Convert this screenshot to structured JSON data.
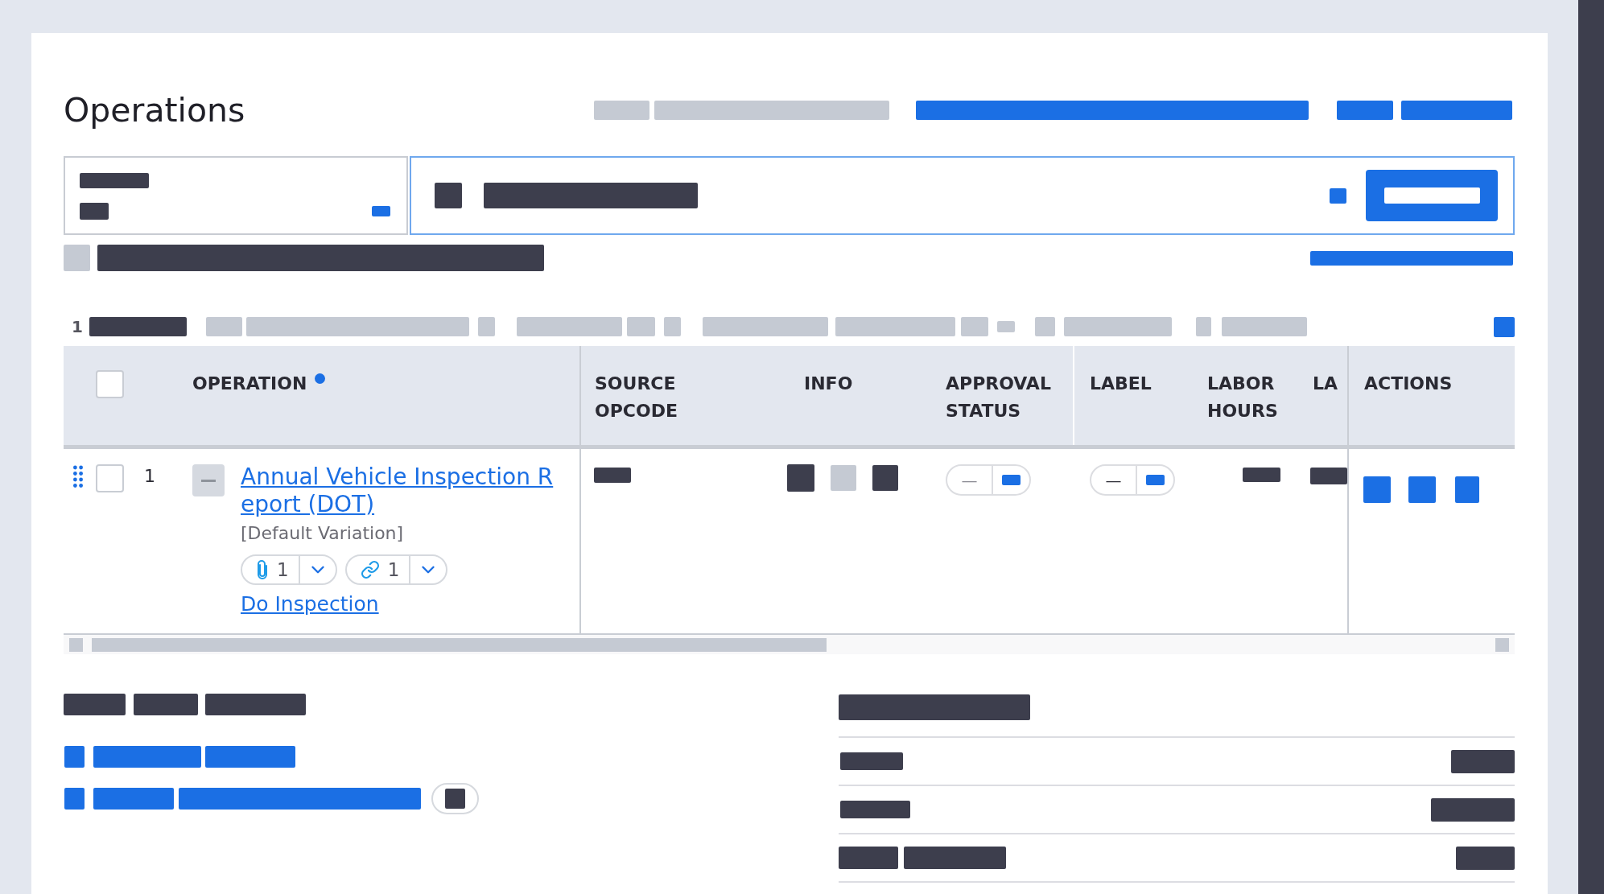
{
  "header": {
    "title": "Operations",
    "redacted": [
      {
        "kind": "muted"
      },
      {
        "kind": "muted"
      },
      {
        "kind": "link"
      },
      {
        "kind": "link"
      },
      {
        "kind": "link"
      }
    ]
  },
  "filter_field": {
    "redacted": [
      {
        "kind": "dark"
      },
      {
        "kind": "dark"
      },
      {
        "kind": "link"
      }
    ]
  },
  "search_field": {
    "focused": true,
    "redacted": [
      {
        "kind": "dark"
      },
      {
        "kind": "dark"
      },
      {
        "kind": "link"
      }
    ]
  },
  "search_button": {
    "redacted": [
      {
        "kind": "light"
      }
    ]
  },
  "summary": {
    "redacted": [
      {
        "kind": "muted"
      },
      {
        "kind": "dark"
      },
      {
        "kind": "link"
      }
    ]
  },
  "toolbar": {
    "count": "1",
    "redacted": [
      {
        "kind": "dark"
      },
      {
        "kind": "muted"
      },
      {
        "kind": "muted"
      },
      {
        "kind": "muted"
      },
      {
        "kind": "muted"
      },
      {
        "kind": "muted"
      },
      {
        "kind": "muted"
      },
      {
        "kind": "muted"
      },
      {
        "kind": "muted"
      },
      {
        "kind": "muted"
      },
      {
        "kind": "muted"
      },
      {
        "kind": "muted"
      },
      {
        "kind": "muted"
      },
      {
        "kind": "muted"
      },
      {
        "kind": "muted"
      },
      {
        "kind": "link"
      }
    ]
  },
  "table": {
    "select_all": {
      "checked": false
    },
    "columns": [
      {
        "label": "OPERATION",
        "indicator": true
      },
      {
        "label": "SOURCE OPCODE",
        "indicator": false
      },
      {
        "label": "INFO",
        "indicator": false
      },
      {
        "label": "APPROVAL STATUS",
        "indicator": false
      },
      {
        "label": "LABEL",
        "indicator": false
      },
      {
        "label": "LABOR HOURS",
        "indicator": false
      },
      {
        "label": "LA",
        "indicator": false
      },
      {
        "label": "ACTIONS",
        "indicator": false
      }
    ],
    "rows": [
      {
        "number": "1",
        "checked": false,
        "expanded": true,
        "cells": [
          {
            "kind": "operation",
            "title": "Annual Vehicle Inspection Report (DOT)",
            "variation": "[Default Variation]",
            "attachments": "1",
            "links": "1",
            "action": "Do Inspection"
          },
          {
            "kind": "redacted",
            "redacted": [
              {
                "kind": "dark"
              }
            ]
          },
          {
            "kind": "redacted",
            "redacted": [
              {
                "kind": "dark"
              },
              {
                "kind": "muted"
              },
              {
                "kind": "dark"
              }
            ]
          },
          {
            "kind": "toggle",
            "value": "—",
            "disabled": true,
            "redacted": [
              {
                "kind": "link"
              }
            ]
          },
          {
            "kind": "toggle",
            "value": "—",
            "disabled": false,
            "redacted": [
              {
                "kind": "link"
              }
            ]
          },
          {
            "kind": "redacted",
            "redacted": [
              {
                "kind": "dark"
              }
            ]
          },
          {
            "kind": "redacted",
            "redacted": [
              {
                "kind": "dark"
              }
            ]
          },
          {
            "kind": "redacted",
            "redacted": [
              {
                "kind": "link"
              },
              {
                "kind": "link"
              },
              {
                "kind": "link"
              }
            ]
          }
        ]
      }
    ]
  },
  "details": {
    "heading": [
      {
        "kind": "dark"
      },
      {
        "kind": "dark"
      },
      {
        "kind": "dark"
      }
    ],
    "links": [
      {
        "redacted": [
          {
            "kind": "link"
          },
          {
            "kind": "link"
          },
          {
            "kind": "link"
          }
        ]
      },
      {
        "redacted": [
          {
            "kind": "link"
          },
          {
            "kind": "link"
          },
          {
            "kind": "link"
          }
        ],
        "badge": [
          {
            "kind": "dark"
          }
        ]
      }
    ]
  },
  "summary_panel": {
    "heading": [
      {
        "kind": "dark"
      }
    ],
    "rows": [
      {
        "label": [
          {
            "kind": "dark"
          }
        ],
        "value": [
          {
            "kind": "dark"
          }
        ]
      },
      {
        "label": [
          {
            "kind": "dark"
          }
        ],
        "value": [
          {
            "kind": "dark"
          }
        ]
      },
      {
        "label": [
          {
            "kind": "dark"
          },
          {
            "kind": "dark"
          }
        ],
        "value": [
          {
            "kind": "dark"
          }
        ]
      }
    ]
  }
}
